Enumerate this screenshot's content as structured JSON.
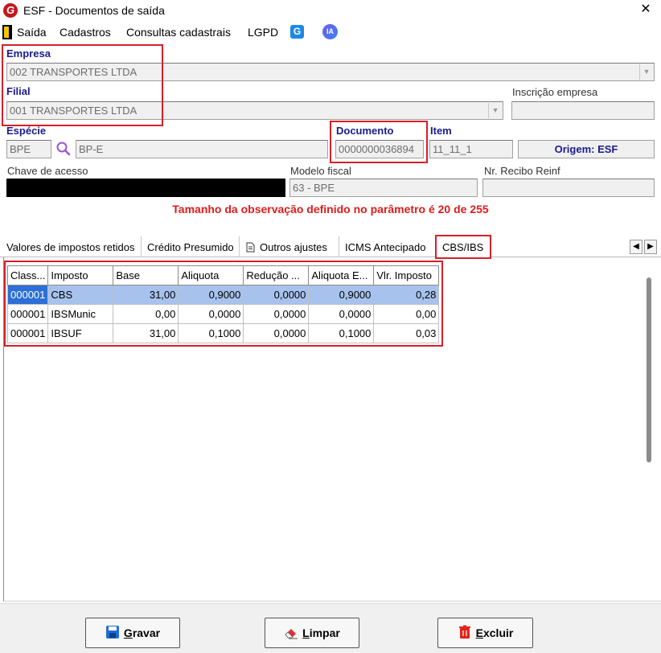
{
  "window": {
    "logo": "G",
    "title": "ESF - Documentos de saída",
    "close": "✕"
  },
  "menu": {
    "items": [
      "Saída",
      "Cadastros",
      "Consultas cadastrais",
      "LGPD"
    ],
    "g_icon": "G",
    "ia_icon": "IA"
  },
  "form": {
    "empresa_label": "Empresa",
    "empresa_value": "002 TRANSPORTES LTDA",
    "filial_label": "Filial",
    "filial_value": "001 TRANSPORTES LTDA",
    "inscricao_label": "Inscrição empresa",
    "inscricao_value": "",
    "especie_label": "Espécie",
    "especie_code": "BPE",
    "especie_desc": "BP-E",
    "documento_label": "Documento",
    "documento_value": "0000000036894",
    "item_label": "Item",
    "item_value": "11_11_1",
    "origem": "Origem: ESF",
    "chave_label": "Chave de acesso",
    "modelo_label": "Modelo fiscal",
    "modelo_value": "63 - BPE",
    "recibo_label": "Nr. Recibo Reinf",
    "recibo_value": ""
  },
  "warning": "Tamanho da observação definido no parâmetro é 20 de 255",
  "tabs": [
    {
      "label": "Valores de impostos retidos"
    },
    {
      "label": "Crédito Presumido"
    },
    {
      "label": "Outros ajustes"
    },
    {
      "label": "ICMS Antecipado"
    },
    {
      "label": "CBS/IBS"
    }
  ],
  "tab_arrows": {
    "left": "◀",
    "right": "▶"
  },
  "grid": {
    "columns": [
      "Class...",
      "Imposto",
      "Base",
      "Aliquota",
      "Redução ...",
      "Aliquota E...",
      "Vlr. Imposto"
    ],
    "rows": [
      [
        "000001",
        "CBS",
        "31,00",
        "0,9000",
        "0,0000",
        "0,9000",
        "0,28"
      ],
      [
        "000001",
        "IBSMunic",
        "0,00",
        "0,0000",
        "0,0000",
        "0,0000",
        "0,00"
      ],
      [
        "000001",
        "IBSUF",
        "31,00",
        "0,1000",
        "0,0000",
        "0,1000",
        "0,03"
      ]
    ]
  },
  "buttons": {
    "gravar_underline": "G",
    "gravar_rest": "ravar",
    "limpar_underline": "L",
    "limpar_rest": "impar",
    "excluir_underline": "E",
    "excluir_rest": "xcluir"
  },
  "colors": {
    "highlight_red": "#d61f2a",
    "label_blue": "#1b1b8c",
    "warning_red": "#e01b1b",
    "selected_row": "#a7c2ed"
  }
}
